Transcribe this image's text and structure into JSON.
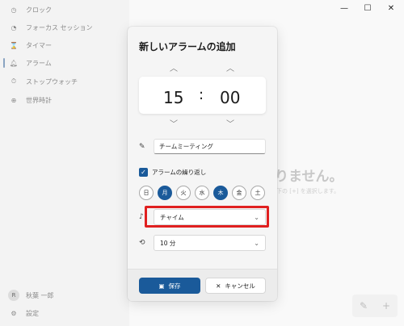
{
  "window_controls": [
    "—",
    "☐",
    "✕"
  ],
  "sidebar": {
    "items": [
      {
        "label": "クロック",
        "icon": "clock-icon"
      },
      {
        "label": "フォーカス セッション",
        "icon": "focus-icon"
      },
      {
        "label": "タイマー",
        "icon": "hourglass-icon"
      },
      {
        "label": "アラーム",
        "icon": "bell-icon"
      },
      {
        "label": "ストップウォッチ",
        "icon": "stopwatch-icon"
      },
      {
        "label": "世界時計",
        "icon": "globe-icon"
      }
    ],
    "user": {
      "initial": "R",
      "name": "秋葉 一郎"
    },
    "settings_label": "設定"
  },
  "main": {
    "empty_text": "りません。",
    "empty_sub": "下の [+] を選択します。"
  },
  "dialog": {
    "title": "新しいアラームの追加",
    "hour": "15",
    "separator": ":",
    "minute": "00",
    "alarm_name": "チームミーティング",
    "repeat_label": "アラームの繰り返し",
    "repeat_checked": true,
    "days": [
      {
        "label": "日",
        "on": false
      },
      {
        "label": "月",
        "on": true
      },
      {
        "label": "火",
        "on": false
      },
      {
        "label": "水",
        "on": false
      },
      {
        "label": "木",
        "on": true
      },
      {
        "label": "金",
        "on": false
      },
      {
        "label": "土",
        "on": false
      }
    ],
    "sound": "チャイム",
    "snooze": "10 分",
    "save_label": "保存",
    "cancel_label": "キャンセル"
  },
  "colors": {
    "accent": "#1a5a9a",
    "highlight": "#e02020"
  }
}
